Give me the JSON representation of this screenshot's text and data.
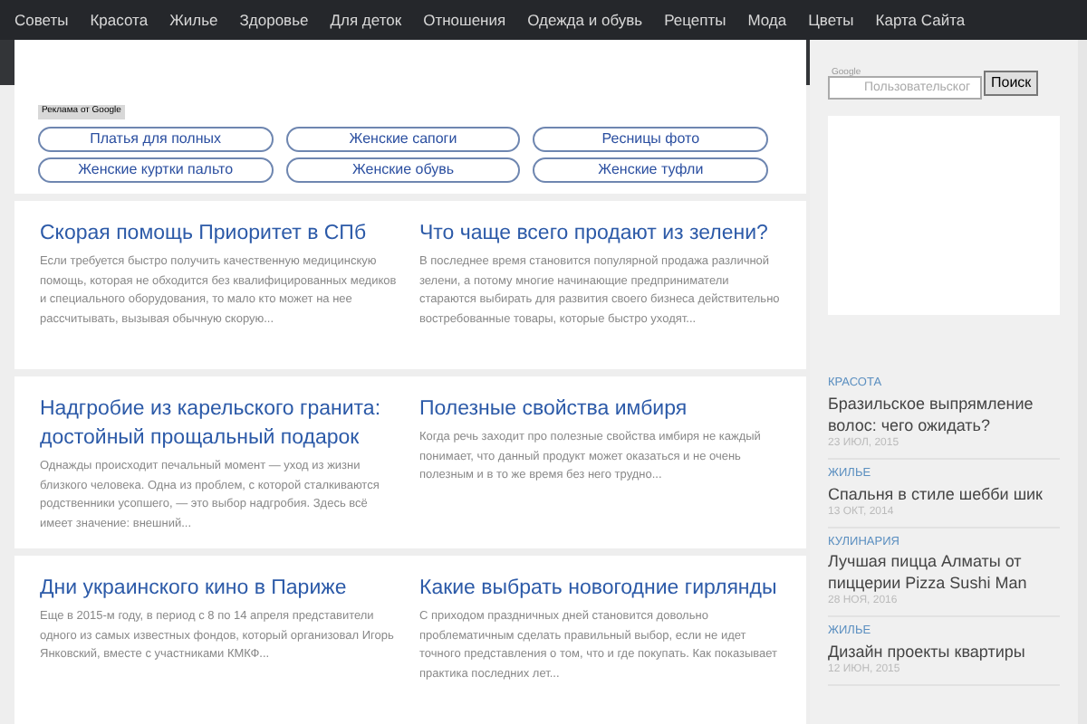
{
  "nav": [
    "Советы",
    "Красота",
    "Жилье",
    "Здоровье",
    "Для деток",
    "Отношения",
    "Одежда и обувь",
    "Рецепты",
    "Мода",
    "Цветы",
    "Карта Сайта"
  ],
  "ads": {
    "label": "Реклама от Google",
    "links": [
      "Платья для полных",
      "Женские сапоги",
      "Ресницы фото",
      "Женские куртки пальто",
      "Женские обувь",
      "Женские туфли"
    ]
  },
  "article_rows": [
    [
      {
        "title": "Скорая помощь Приоритет в СПб",
        "excerpt": "Если требуется быстро получить качественную медицинскую помощь, которая не обходится без квалифицированных медиков и специального оборудования, то мало кто может на нее рассчитывать, вызывая обычную скорую..."
      },
      {
        "title": "Что чаще всего продают из зелени?",
        "excerpt": "В последнее время становится популярной продажа различной зелени, а потому многие начинающие предприниматели стараются выбирать для развития своего бизнеса действительно востребованные товары, которые быстро уходят..."
      }
    ],
    [
      {
        "title": "Надгробие из карельского гранита: достойный прощальный подарок",
        "excerpt": "Однажды происходит печальный момент — уход из жизни близкого человека. Одна из проблем, с которой сталкиваются родственники усопшего, — это выбор надгробия. Здесь всё имеет значение: внешний..."
      },
      {
        "title": "Полезные свойства имбиря",
        "excerpt": "Когда речь заходит про полезные свойства имбиря не каждый понимает, что данный продукт может оказаться и не очень полезным и в то же время без него трудно..."
      }
    ],
    [
      {
        "title": "Дни украинского кино в Париже",
        "excerpt": "Еще в 2015-м году, в период с 8 по 14 апреля представители одного из самых известных фондов, который организовал Игорь Янковский, вместе с участниками КМКФ..."
      },
      {
        "title": "Какие выбрать новогодние гирлянды",
        "excerpt": "С приходом праздничных дней становится довольно проблематичным сделать правильный выбор, если не идет точного представления о том, что и где покупать. Как показывает практика последних лет..."
      }
    ]
  ],
  "search": {
    "brand": "Google",
    "placeholder": "Пользовательског",
    "button": "Поиск"
  },
  "sidebar_posts": [
    {
      "category": "КРАСОТА",
      "title": "Бразильское выпрямление волос: чего ожидать?",
      "date": "23 ИЮЛ, 2015"
    },
    {
      "category": "ЖИЛЬЕ",
      "title": "Спальня в стиле шебби шик",
      "date": "13 ОКТ, 2014"
    },
    {
      "category": "КУЛИНАРИЯ",
      "title": "Лучшая пицца Алматы от пиццерии Pizza Sushi Man",
      "date": "28 НОЯ, 2016"
    },
    {
      "category": "ЖИЛЬЕ",
      "title": "Дизайн проекты квартиры",
      "date": "12 ИЮН, 2015"
    }
  ]
}
